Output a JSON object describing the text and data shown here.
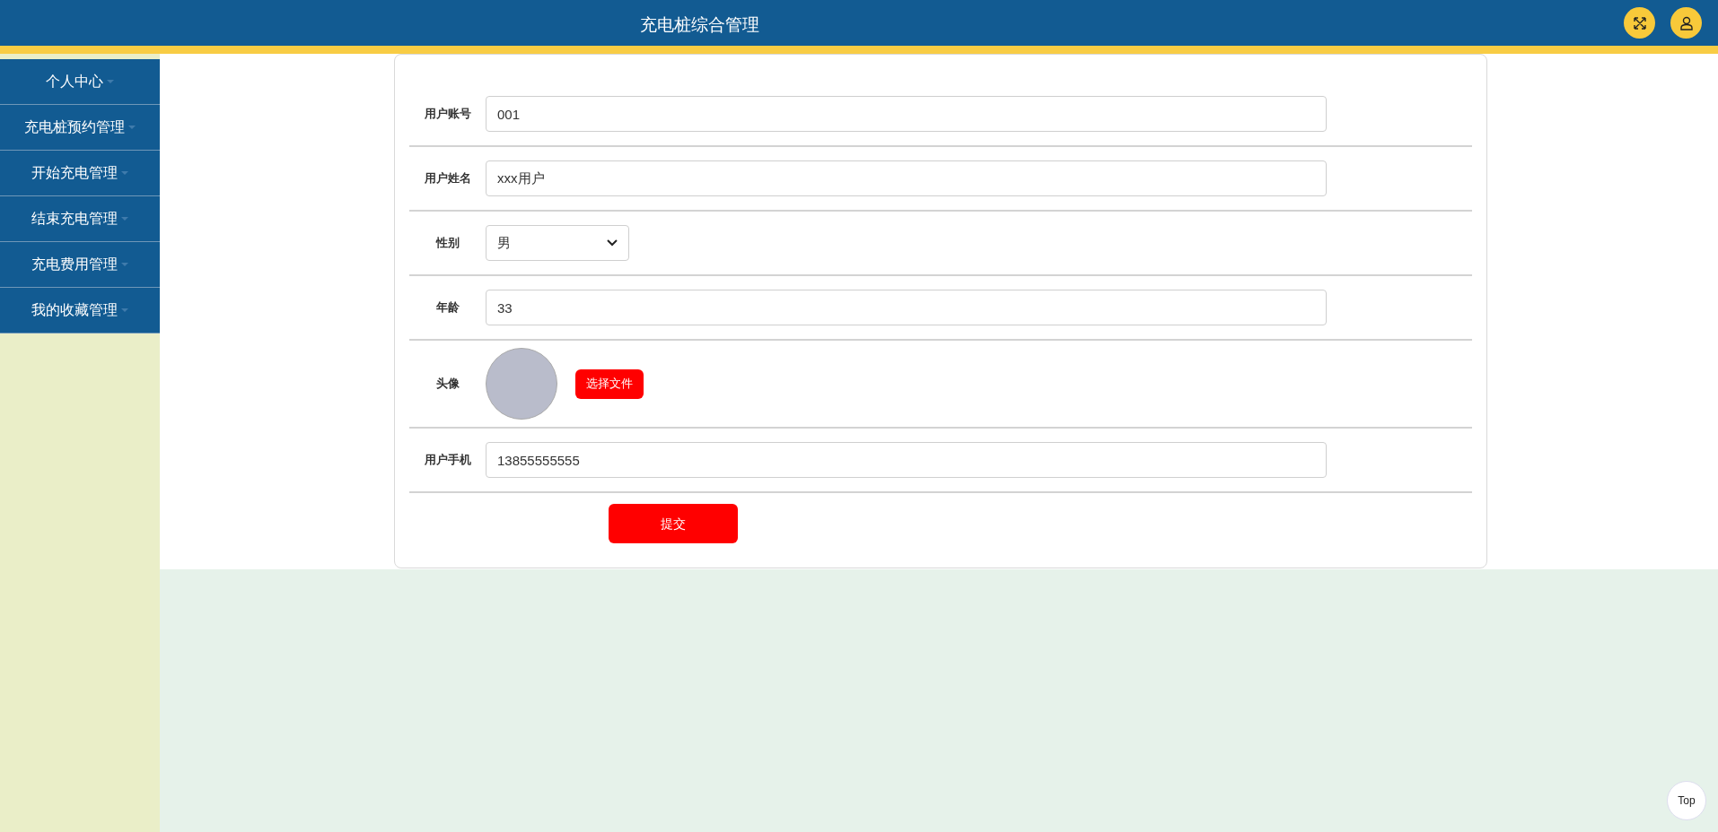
{
  "header": {
    "title": "充电桩综合管理"
  },
  "sidebar": {
    "items": [
      {
        "label": "个人中心"
      },
      {
        "label": "充电桩预约管理"
      },
      {
        "label": "开始充电管理"
      },
      {
        "label": "结束充电管理"
      },
      {
        "label": "充电费用管理"
      },
      {
        "label": "我的收藏管理"
      }
    ]
  },
  "form": {
    "fields": [
      {
        "kind": "text",
        "label": "用户账号",
        "value": "001"
      },
      {
        "kind": "text",
        "label": "用户姓名",
        "value": "xxx用户"
      },
      {
        "kind": "select",
        "label": "性别",
        "value": "男"
      },
      {
        "kind": "text",
        "label": "年龄",
        "value": "33"
      },
      {
        "kind": "image",
        "label": "头像",
        "button": "选择文件"
      },
      {
        "kind": "text",
        "label": "用户手机",
        "value": "13855555555"
      }
    ],
    "submit": "提交"
  },
  "back_to_top": "Top"
}
